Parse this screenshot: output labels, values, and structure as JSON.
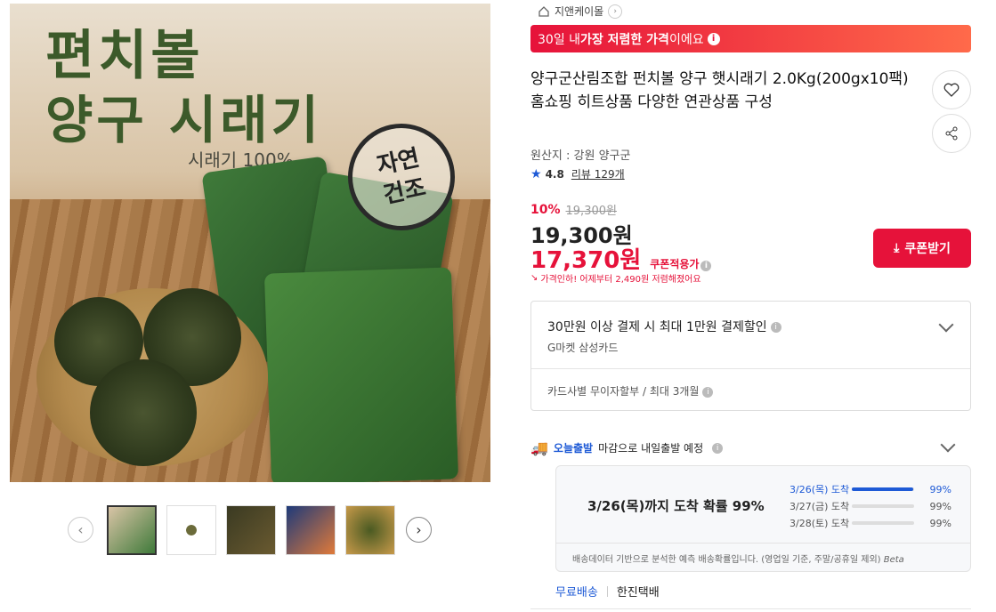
{
  "gallery": {
    "main_image": {
      "title_line1": "편치볼",
      "title_line2": "양구 시래기",
      "subtitle": "시래기 100%",
      "stamp": "자연\n건조"
    },
    "prev_icon": "chevron-left-icon",
    "next_icon": "chevron-right-icon",
    "thumbnails": [
      {
        "id": "thumb-1",
        "selected": true
      },
      {
        "id": "thumb-2",
        "selected": false
      },
      {
        "id": "thumb-3",
        "selected": false
      },
      {
        "id": "thumb-4",
        "selected": false
      },
      {
        "id": "thumb-5",
        "selected": false
      }
    ]
  },
  "breadcrumb": {
    "home_icon": "home-icon",
    "seller": "지앤케이몰"
  },
  "banner": {
    "prefix": "30일 내 ",
    "bold": "가장 저렴한 가격",
    "suffix": "이에요"
  },
  "product": {
    "title": "양구군산림조합 펀치볼 양구 햇시래기 2.0Kg(200gx10팩) 홈쇼핑 히트상품 다양한 연관상품 구성",
    "origin": "원산지 : 강원 양구군",
    "rating": "4.8",
    "review_label": "리뷰 129개"
  },
  "price": {
    "discount_pct": "10%",
    "original": "19,300원",
    "sale": "19,300원",
    "coupon_price": "17,370원",
    "coupon_label": "쿠폰적용가",
    "drop_note": "가격인하! 어제부터 2,490원 저렴해졌어요",
    "coupon_button": "쿠폰받기"
  },
  "card": {
    "promo": "30만원 이상 결제 시 최대 1만원 결제할인",
    "promo_card": "G마켓 삼성카드",
    "installment": "카드사별 무이자할부 / 최대 3개월"
  },
  "shipping": {
    "tag": "오늘출발",
    "text": "마감으로 내일출발 예정",
    "headline": "3/26(목)까지 도착 확률 99%",
    "rows": [
      {
        "date": "3/26(목) 도착",
        "pct": "99%",
        "value": 0.99
      },
      {
        "date": "3/27(금) 도착",
        "pct": "99%",
        "value": 0
      },
      {
        "date": "3/28(토) 도착",
        "pct": "99%",
        "value": 0
      }
    ],
    "note": "배송데이터 기반으로 분석한 예측 배송확률입니다. (영업일 기준, 주말/공휴일 제외)",
    "beta": "Beta",
    "free": "무료배송",
    "courier": "한진택배"
  },
  "colors": {
    "accent_red": "#e6123a",
    "accent_blue": "#1e5ad6"
  }
}
